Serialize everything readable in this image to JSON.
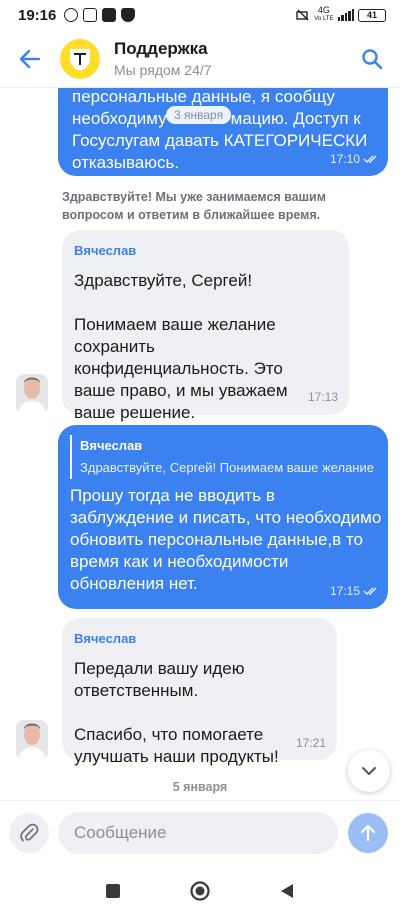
{
  "status_bar": {
    "time": "19:16",
    "network_top": "4G",
    "network_bottom": "Vo LTE",
    "battery": "41"
  },
  "header": {
    "title": "Поддержка",
    "subtitle": "Мы рядом 24/7"
  },
  "messages": {
    "m1": {
      "text_lines": [
        "персональные данные, я сообщу",
        "необходиму",
        "мацию. Доступ к",
        "Госуслугам давать КАТЕГОРИЧЕСКИ",
        "отказываюсь."
      ],
      "line1": "персональные данные, я сообщу",
      "line2a": "необходиму",
      "line2b": "мацию. Доступ к",
      "line3": "Госуслугам давать КАТЕГОРИЧЕСКИ",
      "line4": "отказываюсь.",
      "time": "17:10",
      "date_overlay": "3 января"
    },
    "system": "Здравствуйте! Мы уже занимаемся вашим вопросом и ответим в ближайшее время.",
    "m2": {
      "sender": "Вячеслав",
      "para1": "Здравствуйте, Сергей!",
      "para2": "Понимаем ваше желание сохранить конфиденциальность. Это ваше право, и мы уважаем ваше решение.",
      "time": "17:13"
    },
    "m3": {
      "quote_name": "Вячеслав",
      "quote_text": "Здравствуйте, Сергей! Понимаем ваше желание",
      "text": "Прошу тогда не вводить в заблуждение и писать, что необходимо обновить персональные данные,в то время как и необходимости обновления нет.",
      "time": "17:15"
    },
    "m4": {
      "sender": "Вячеслав",
      "para1": "Передали вашу идею ответственным.",
      "para2": "Спасибо, что помогаете улучшать наши продукты!",
      "time": "17:21"
    },
    "date_divider": "5 января"
  },
  "composer": {
    "placeholder": "Сообщение"
  },
  "colors": {
    "accent": "#3b82f0",
    "incoming_bubble": "#eef0f3",
    "brand_yellow": "#ffdd2d"
  }
}
